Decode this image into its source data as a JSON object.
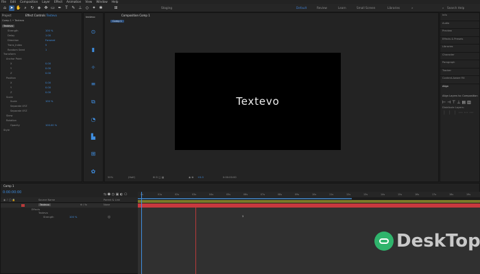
{
  "menu": [
    "File",
    "Edit",
    "Composition",
    "Layer",
    "Effect",
    "Animation",
    "View",
    "Window",
    "Help"
  ],
  "workspaces": {
    "default": "Default",
    "review": "Review",
    "learn": "Learn",
    "small_screen": "Small Screen",
    "libraries": "Libraries",
    "search": "Search Help",
    "staging": "Staging"
  },
  "project_panel": {
    "tab_project": "Project",
    "tab_effect_controls": "Effect Controls",
    "layer": "Textevo",
    "breadcrumb": "Comp 1 • Textevo"
  },
  "effects": {
    "items": [
      {
        "name": "Textevo",
        "value": ""
      },
      {
        "name": "Strength",
        "value": "100 %"
      },
      {
        "name": "Delay",
        "value": "1.00"
      },
      {
        "name": "Direction",
        "value": "Forward"
      },
      {
        "name": "Trans_Index",
        "value": "5"
      },
      {
        "name": "Random Seed",
        "value": "1"
      },
      {
        "name": "Transform",
        "value": ""
      },
      {
        "name": "Anchor Point",
        "value": ""
      },
      {
        "name": "X",
        "value": "0.00"
      },
      {
        "name": "Y",
        "value": "0.00"
      },
      {
        "name": "Z",
        "value": "0.00"
      },
      {
        "name": "Position",
        "value": ""
      },
      {
        "name": "X",
        "value": "0.00"
      },
      {
        "name": "Y",
        "value": "0.00"
      },
      {
        "name": "Z",
        "value": "0.00"
      },
      {
        "name": "Scale",
        "value": ""
      },
      {
        "name": "Scale",
        "value": "100 %"
      },
      {
        "name": "Separate XYZ",
        "value": ""
      },
      {
        "name": "Separate XYZ",
        "value": ""
      },
      {
        "name": "Skew",
        "value": ""
      },
      {
        "name": "Rotation",
        "value": ""
      },
      {
        "name": "Opacity",
        "value": "100.00 %"
      },
      {
        "name": "Style",
        "value": ""
      }
    ]
  },
  "side_tools": {
    "label": "textevo"
  },
  "composition": {
    "tab": "Composition Comp 1",
    "subtab": "Comp 1",
    "preview_text": "Textevo",
    "zoom": "50%",
    "resolution": "(Half)",
    "timecode_view": "0:00:00:00",
    "exposure": "+0.0"
  },
  "right_panel": {
    "items": [
      "Info",
      "Audio",
      "Preview",
      "Effects & Presets",
      "Libraries",
      "Character",
      "Paragraph",
      "Tracker",
      "Content-Aware Fill",
      "Align"
    ],
    "align_to_label": "Align Layers to:",
    "align_to_value": "Composition",
    "distribute_label": "Distribute Layers:"
  },
  "timeline": {
    "tab": "Comp 1",
    "timecode": "0:00:00:00",
    "col_source": "Source Name",
    "col_parent": "Parent & Link",
    "layer_name": "Textevo",
    "parent_value": "None",
    "sub_effects": "Effects",
    "sub_textevo": "Textevo",
    "sub_strength": "Strength",
    "strength_value": "100 %",
    "ticks": [
      "0s",
      "01s",
      "02s",
      "03s",
      "04s",
      "05s",
      "06s",
      "07s",
      "08s",
      "09s",
      "10s",
      "11s",
      "12s",
      "13s",
      "14s",
      "15s",
      "16s",
      "17s",
      "18s",
      "19s"
    ],
    "marker": "3"
  },
  "watermark": {
    "text": "DeskTop",
    "colors": {
      "green": "#2fb46c",
      "gray": "#c9c9c9"
    }
  },
  "colors": {
    "accent": "#3f8ee0",
    "bg": "#1d1d1d",
    "work_area": "#d03a3a"
  }
}
